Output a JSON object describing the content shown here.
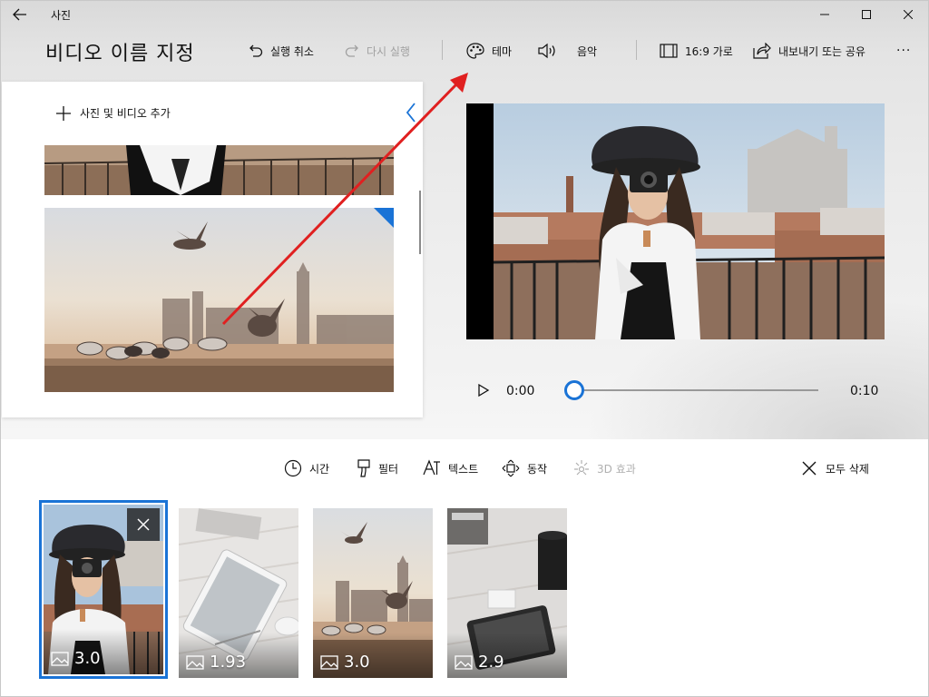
{
  "window": {
    "app_title": "사진",
    "controls": {
      "minimize": "minimize-icon",
      "maximize": "maximize-icon",
      "close": "close-icon"
    }
  },
  "toolbar": {
    "video_title": "비디오 이름 지정",
    "undo_label": "실행 취소",
    "redo_label": "다시 실행",
    "theme_label": "테마",
    "music_label": "음악",
    "aspect_label": "16:9 가로",
    "export_label": "내보내기 또는 공유",
    "more_label": "···"
  },
  "library": {
    "add_label": "사진 및 비디오 추가"
  },
  "player": {
    "time_current": "0:00",
    "time_total": "0:10",
    "progress": 0.0
  },
  "edit_bar": {
    "duration_label": "시간",
    "filters_label": "필터",
    "text_label": "텍스트",
    "motion_label": "동작",
    "effects_3d_label": "3D 효과",
    "remove_all_label": "모두 삭제"
  },
  "storyboard": {
    "cards": [
      {
        "duration": "3.0",
        "selected": true
      },
      {
        "duration": "1.93",
        "selected": false
      },
      {
        "duration": "3.0",
        "selected": false
      },
      {
        "duration": "2.9",
        "selected": false
      }
    ]
  },
  "colors": {
    "accent": "#1a73d6",
    "annotation_arrow": "#e02020"
  }
}
